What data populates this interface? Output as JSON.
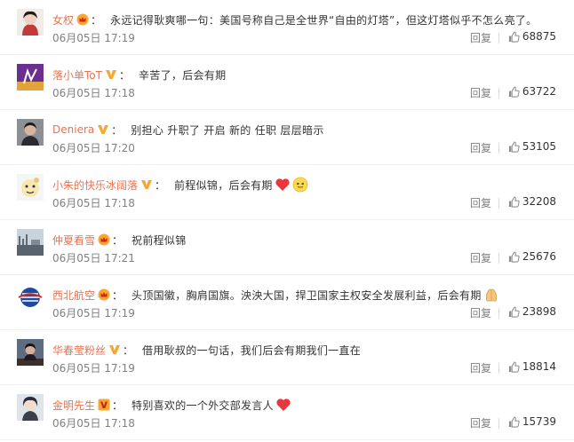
{
  "comments": [
    {
      "user": "女权",
      "badge": "crown",
      "sep": "：",
      "text": "永远记得耿爽哪一句：美国号称自己是全世界“自由的灯塔”，但这灯塔似乎不怎么亮了。",
      "time": "06月05日 17:19",
      "reply": "回复",
      "likes": "68875",
      "emoji": [],
      "avatar_icon": "girl-portrait"
    },
    {
      "user": "落小单ToT",
      "badge": "v-verified",
      "sep": "：",
      "text": "辛苦了，后会有期",
      "time": "06月05日 17:18",
      "reply": "回复",
      "likes": "63722",
      "emoji": [],
      "avatar_icon": "purple-graphic"
    },
    {
      "user": "Deniera",
      "badge": "v-verified",
      "sep": "：",
      "text": "别担心 升职了 开启 新的 任职 层层暗示",
      "time": "06月05日 17:20",
      "reply": "回复",
      "likes": "53105",
      "emoji": [],
      "avatar_icon": "man-portrait"
    },
    {
      "user": "小朱的快乐冰阔落",
      "badge": "v-verified",
      "sep": "：",
      "text": "前程似锦，后会有期",
      "time": "06月05日 17:18",
      "reply": "回复",
      "likes": "32208",
      "emoji": [
        "heart",
        "smile"
      ],
      "avatar_icon": "cartoon-face"
    },
    {
      "user": "仲夏看雪",
      "badge": "crown",
      "sep": "：",
      "text": "祝前程似锦",
      "time": "06月05日 17:21",
      "reply": "回复",
      "likes": "25676",
      "emoji": [],
      "avatar_icon": "landscape-photo"
    },
    {
      "user": "西北航空",
      "badge": "crown",
      "sep": "：",
      "text": "头顶国徽，胸肩国旗。泱泱大国，捍卫国家主权安全发展利益，后会有期",
      "time": "06月05日 17:19",
      "reply": "回复",
      "likes": "23898",
      "emoji": [
        "hands"
      ],
      "avatar_icon": "airline-logo"
    },
    {
      "user": "华春莹粉丝",
      "badge": "v-verified",
      "sep": "：",
      "text": "借用耿叔的一句话，我们后会有期我们一直在",
      "time": "06月05日 17:19",
      "reply": "回复",
      "likes": "18814",
      "emoji": [],
      "avatar_icon": "speaker-photo"
    },
    {
      "user": "金明先生",
      "badge": "v-gold",
      "sep": "：",
      "text": "特别喜欢的一个外交部发言人",
      "time": "06月05日 17:18",
      "reply": "回复",
      "likes": "15739",
      "emoji": [
        "heart"
      ],
      "avatar_icon": "anime-portrait"
    }
  ],
  "colors": {
    "username": "#eb7350",
    "meta": "#808080",
    "text": "#333333",
    "badge_gold": "#f7a72f",
    "heart": "#e8383d"
  }
}
